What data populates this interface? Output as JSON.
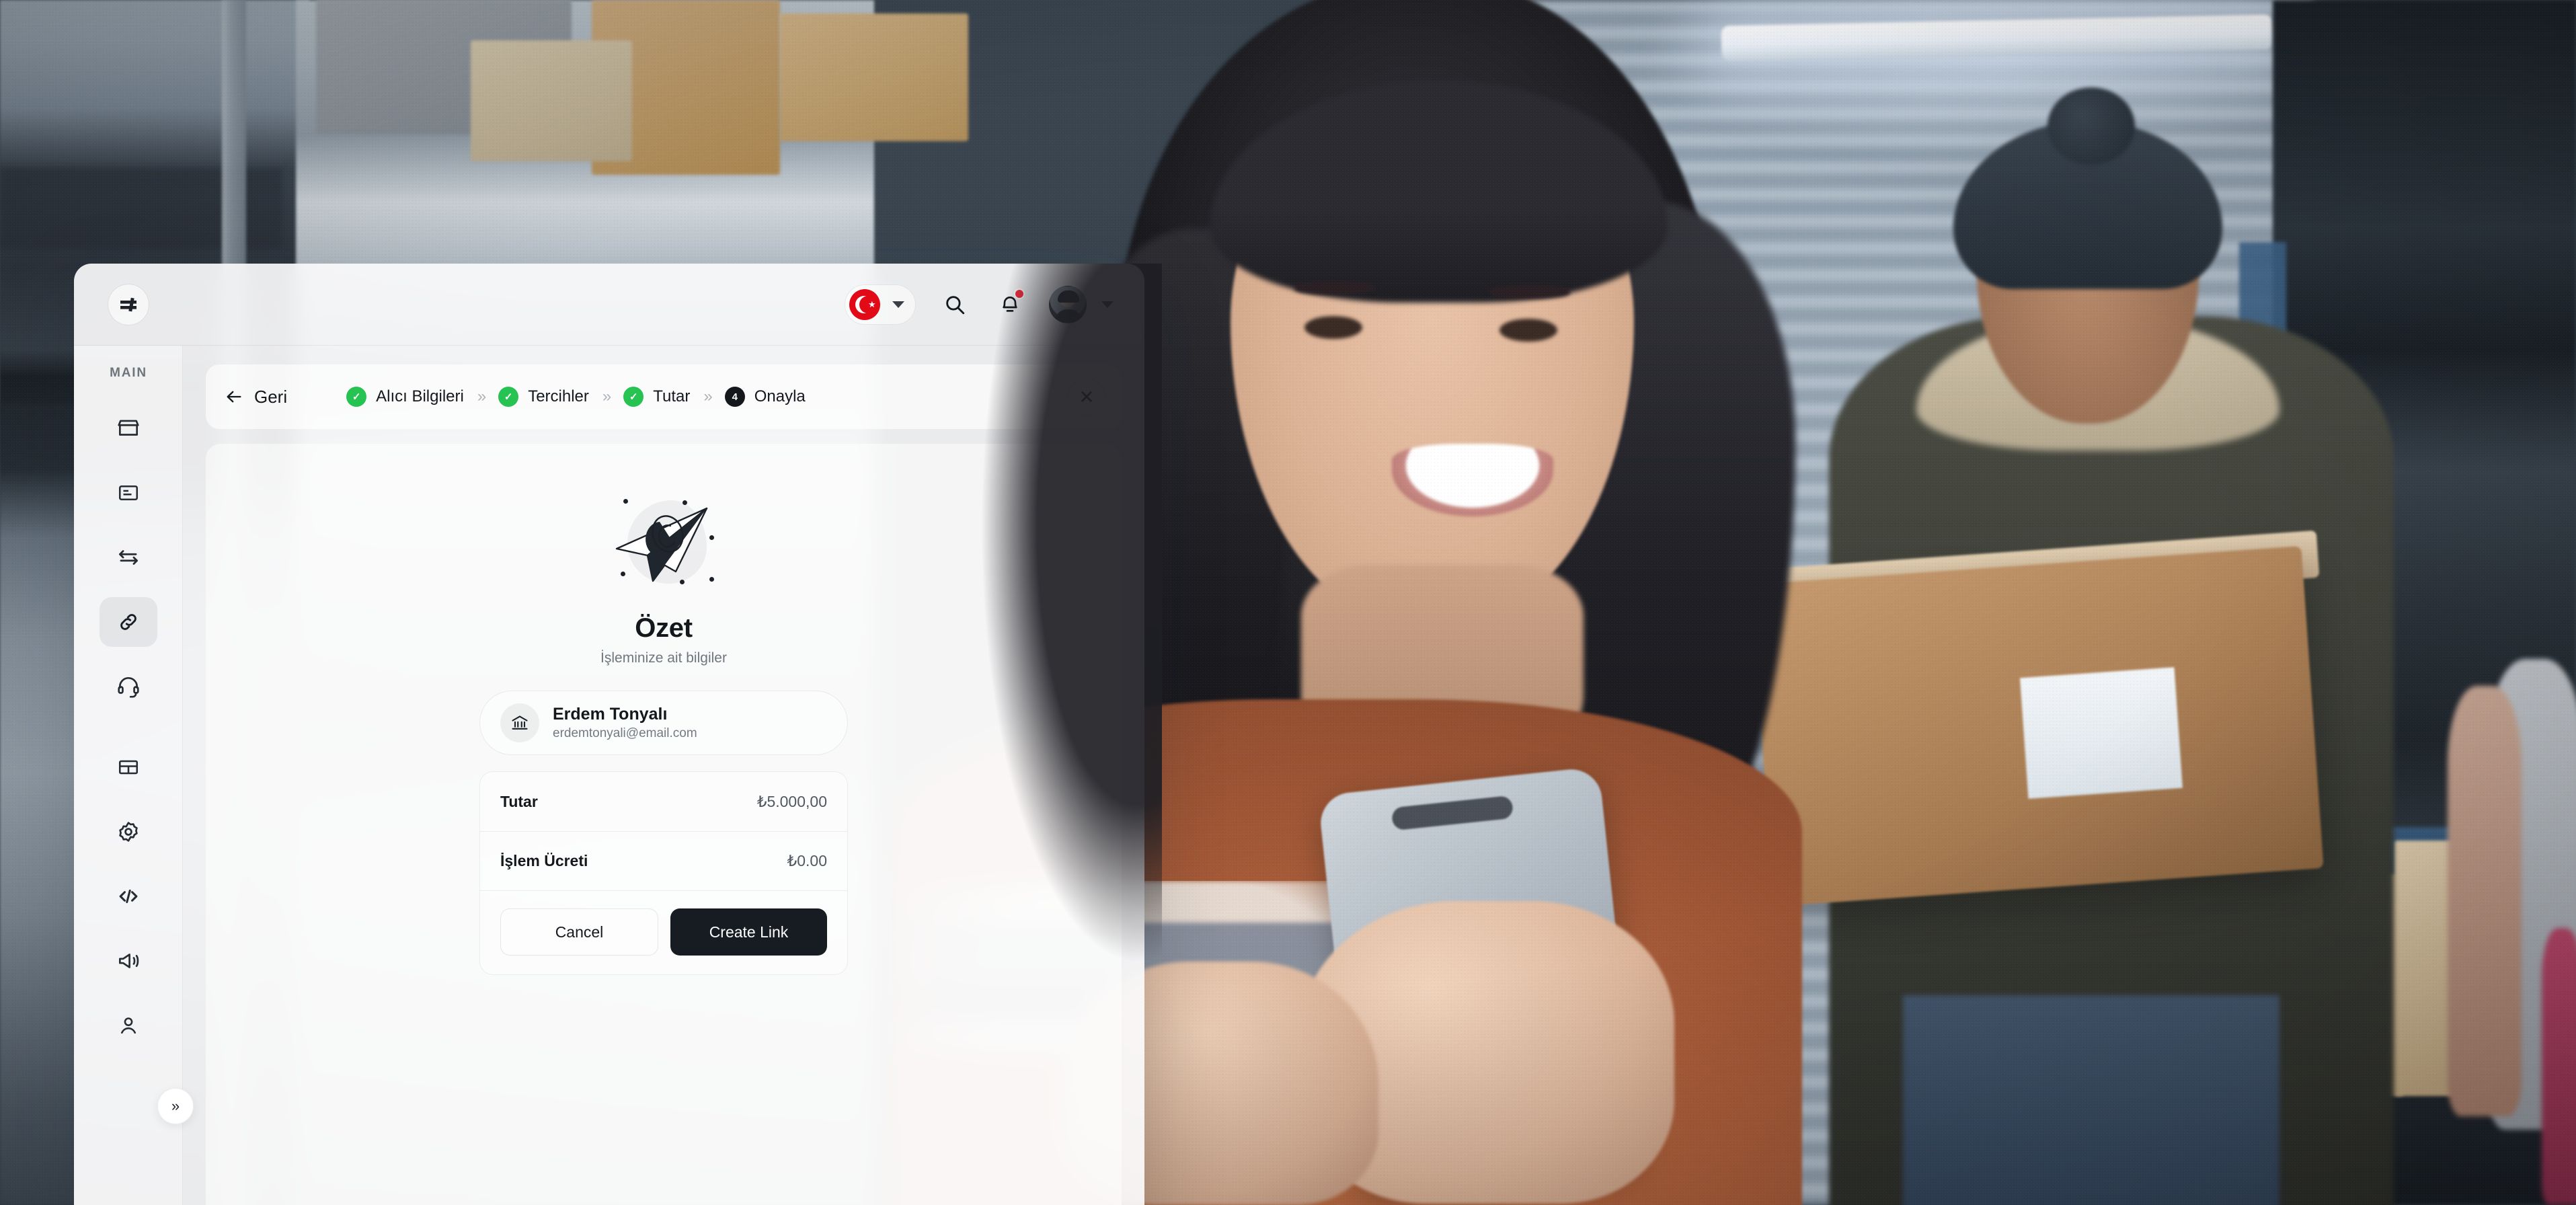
{
  "app": {
    "logo_glyph": "⟝",
    "logo_name": "papara-logo"
  },
  "topbar": {
    "language": {
      "label": "TR",
      "flag": "turkish-flag",
      "star": "★"
    },
    "search_label": "Search",
    "notifications_label": "Notifications",
    "has_unread": true,
    "account_label": "Account"
  },
  "sidebar": {
    "section_label": "MAIN",
    "collapse_label": "»",
    "items": [
      {
        "name": "store",
        "icon": "store-icon",
        "active": false
      },
      {
        "name": "statements",
        "icon": "document-icon",
        "active": false
      },
      {
        "name": "transfers",
        "icon": "transfer-arrows-icon",
        "active": false
      },
      {
        "name": "links",
        "icon": "link-chain-icon",
        "active": true
      },
      {
        "name": "support",
        "icon": "headset-icon",
        "active": false
      },
      {
        "name": "tables",
        "icon": "grid-table-icon",
        "active": false
      },
      {
        "name": "settings",
        "icon": "gear-icon",
        "active": false
      },
      {
        "name": "developers",
        "icon": "code-icon",
        "active": false
      },
      {
        "name": "announcements",
        "icon": "megaphone-icon",
        "active": false
      },
      {
        "name": "profile",
        "icon": "user-icon",
        "active": false
      }
    ]
  },
  "stepper": {
    "back_label": "Geri",
    "separator": "»",
    "close_label": "✕",
    "steps": [
      {
        "label": "Alıcı Bilgileri",
        "state": "done",
        "marker": "✓"
      },
      {
        "label": "Tercihler",
        "state": "done",
        "marker": "✓"
      },
      {
        "label": "Tutar",
        "state": "done",
        "marker": "✓"
      },
      {
        "label": "Onayla",
        "state": "current",
        "marker": "4"
      }
    ]
  },
  "summary": {
    "illustration": "paper-plane-illustration",
    "title": "Özet",
    "subtitle": "İşleminize ait bilgiler",
    "recipient": {
      "icon": "bank-icon",
      "name": "Erdem Tonyalı",
      "email": "erdemtonyali@email.com"
    },
    "rows": [
      {
        "label": "Tutar",
        "value": "₺5.000,00"
      },
      {
        "label": "İşlem Ücreti",
        "value": "₺0.00"
      }
    ],
    "cancel_label": "Cancel",
    "submit_label": "Create Link"
  },
  "colors": {
    "accent_green": "#26C252",
    "current_step": "#14181d",
    "primary_button": "#171c22",
    "flag_red": "#E30A17",
    "badge_red": "#EF2B3D"
  }
}
